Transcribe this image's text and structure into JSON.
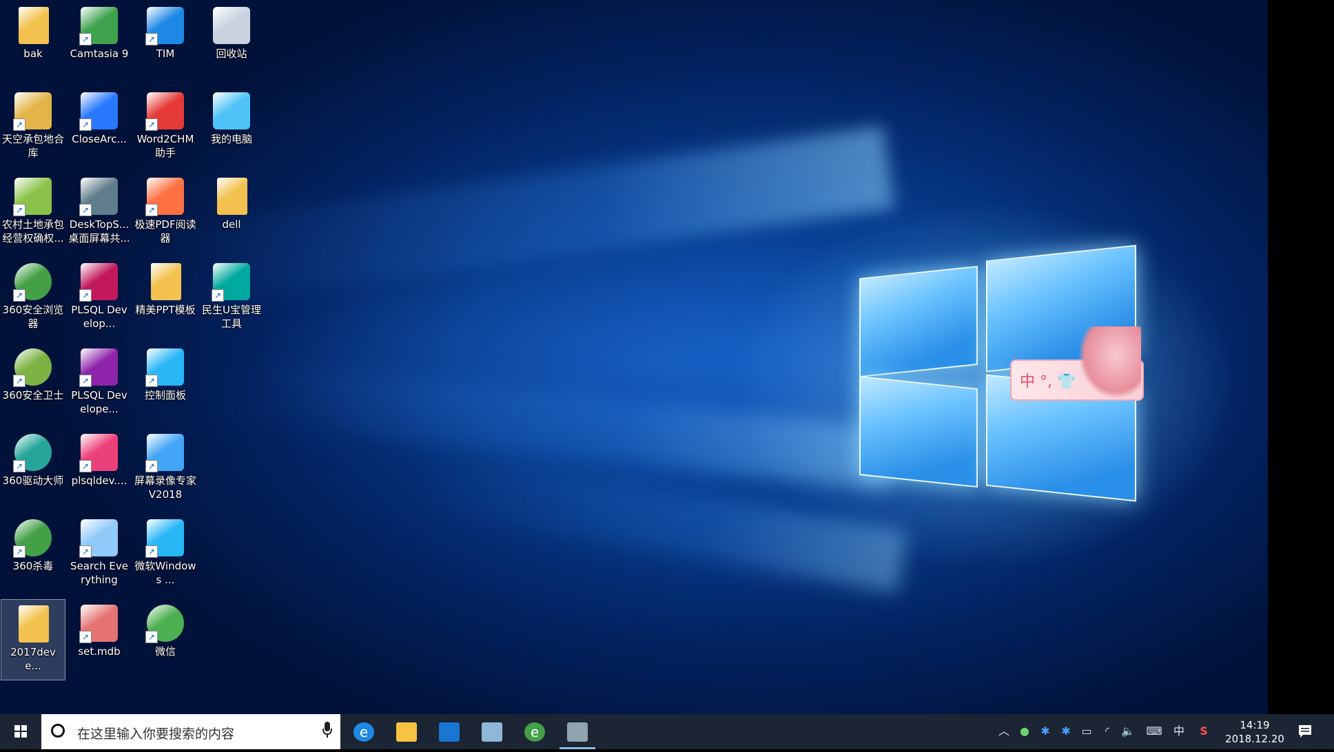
{
  "desktop_icons": [
    {
      "label": "bak",
      "icon": "folder-icon",
      "color": "#f2c14e"
    },
    {
      "label": "Camtasia 9",
      "icon": "camtasia-icon",
      "color": "#3fa34d"
    },
    {
      "label": "TIM",
      "icon": "tim-icon",
      "color": "#1e88e5"
    },
    {
      "label": "回收站",
      "icon": "recycle-bin-icon",
      "color": "#c8d3df"
    },
    {
      "label": "天空承包地合库",
      "icon": "database-icon",
      "color": "#e3b448"
    },
    {
      "label": "CloseArc...",
      "icon": "window-app-icon",
      "color": "#2979ff"
    },
    {
      "label": "Word2CHM助手",
      "icon": "word2chm-icon",
      "color": "#e53935"
    },
    {
      "label": "我的电脑",
      "icon": "computer-icon",
      "color": "#4fc3f7"
    },
    {
      "label": "农村土地承包经营权确权...",
      "icon": "land-app-icon",
      "color": "#8bc34a"
    },
    {
      "label": "DeskTopS...桌面屏幕共...",
      "icon": "monitor-icon",
      "color": "#607d8b"
    },
    {
      "label": "极速PDF阅读器",
      "icon": "pdf-icon",
      "color": "#ff7043"
    },
    {
      "label": "dell",
      "icon": "user-folder-icon",
      "color": "#f2c14e"
    },
    {
      "label": "360安全浏览器",
      "icon": "360-browser-icon",
      "color": "#43a047"
    },
    {
      "label": "PLSQL Develop...",
      "icon": "plsql-icon",
      "color": "#c2185b"
    },
    {
      "label": "精美PPT模板",
      "icon": "folder-icon",
      "color": "#f2c14e"
    },
    {
      "label": "民生U宝管理工具",
      "icon": "minsheng-icon",
      "color": "#00a99d"
    },
    {
      "label": "360安全卫士",
      "icon": "360-guard-icon",
      "color": "#7cb342"
    },
    {
      "label": "PLSQL Develope...",
      "icon": "archive-icon",
      "color": "#8e24aa"
    },
    {
      "label": "控制面板",
      "icon": "control-panel-icon",
      "color": "#29b6f6"
    },
    {
      "label": "360驱动大师",
      "icon": "360-driver-icon",
      "color": "#26a69a"
    },
    {
      "label": "plsqldev....",
      "icon": "plsqldev-icon",
      "color": "#ec407a"
    },
    {
      "label": "屏幕录像专家V2018",
      "icon": "screen-recorder-icon",
      "color": "#42a5f5"
    },
    {
      "label": "360杀毒",
      "icon": "360-antivirus-icon",
      "color": "#43a047"
    },
    {
      "label": "Search Everything",
      "icon": "search-everything-icon",
      "color": "#90caf9"
    },
    {
      "label": "微软Windows ...",
      "icon": "windows-icon",
      "color": "#29b6f6"
    },
    {
      "label": "2017deve...",
      "icon": "folder-icon",
      "color": "#f2c14e"
    },
    {
      "label": "set.mdb",
      "icon": "mdb-file-icon",
      "color": "#e57373"
    },
    {
      "label": "微信",
      "icon": "wechat-icon",
      "color": "#4caf50"
    }
  ],
  "sticker": {
    "text": "中 °, 👕"
  },
  "taskbar": {
    "search_placeholder": "在这里输入你要搜索的内容",
    "apps": [
      {
        "name": "edge-icon",
        "color": "#1e88e5",
        "glyph": "e"
      },
      {
        "name": "file-explorer-icon",
        "color": "#f6c343",
        "glyph": ""
      },
      {
        "name": "store-icon",
        "color": "#1976d2",
        "glyph": ""
      },
      {
        "name": "app-icon",
        "color": "#8fb8d8",
        "glyph": ""
      },
      {
        "name": "360-browser-icon",
        "color": "#43a047",
        "glyph": "e"
      },
      {
        "name": "paint-icon",
        "color": "#90a4ae",
        "glyph": ""
      }
    ],
    "tray": {
      "input_method": "中",
      "time": "14:19",
      "date": "2018.12.20"
    }
  }
}
